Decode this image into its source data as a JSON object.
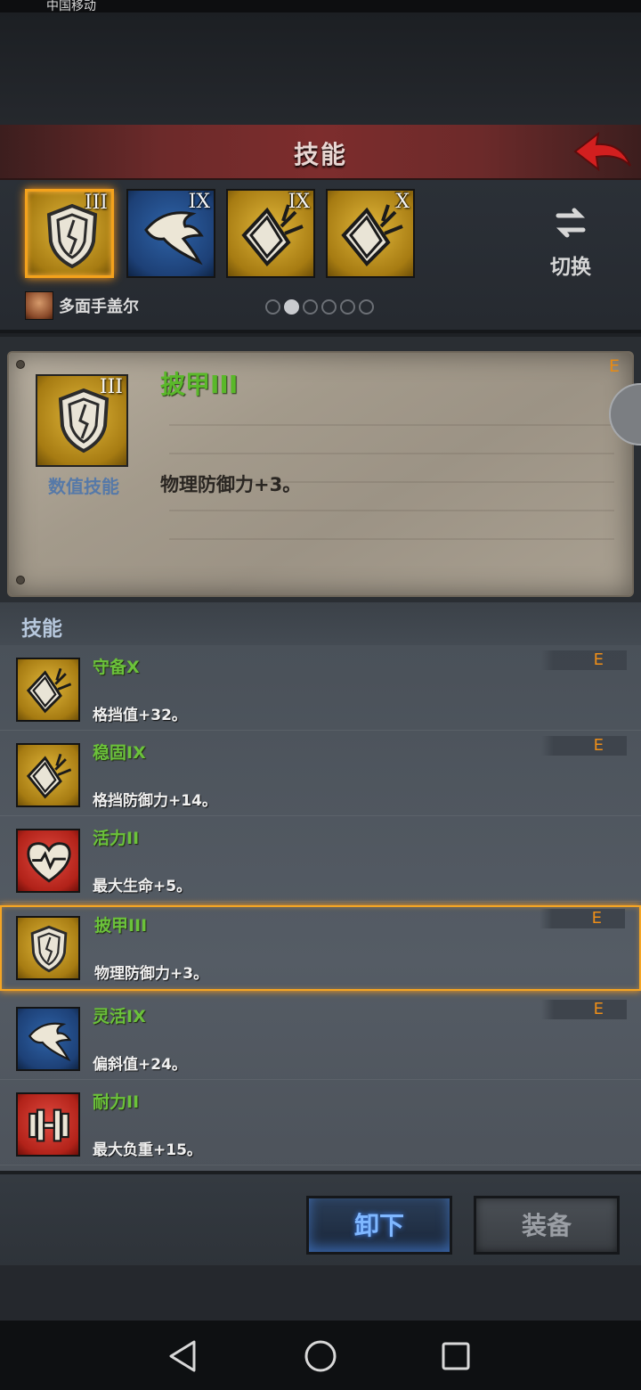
{
  "status_bar": {
    "carrier": "中国移动",
    "right": ""
  },
  "header": {
    "title": "技能"
  },
  "slots": [
    {
      "icon": "shield-icon",
      "roman": "III",
      "color": "gold",
      "selected": true
    },
    {
      "icon": "feather-icon",
      "roman": "IX",
      "color": "blue",
      "selected": false
    },
    {
      "icon": "block-shield-icon",
      "roman": "IX",
      "color": "gold",
      "selected": false
    },
    {
      "icon": "block-shield-icon",
      "roman": "X",
      "color": "gold",
      "selected": false
    }
  ],
  "switch_label": "切换",
  "character": {
    "name": "多面手盖尔"
  },
  "page_dots": {
    "total": 6,
    "active_index": 1
  },
  "detail": {
    "name": "披甲III",
    "roman": "III",
    "type": "数值技能",
    "desc": "物理防御力+3。",
    "grade": "E"
  },
  "list_header": "技能",
  "skills": [
    {
      "name": "守备X",
      "desc": "格挡值+32。",
      "grade": "E",
      "icon": "block-shield-icon",
      "color": "gold"
    },
    {
      "name": "稳固IX",
      "desc": "格挡防御力+14。",
      "grade": "E",
      "icon": "block-shield-icon",
      "color": "gold"
    },
    {
      "name": "活力II",
      "desc": "最大生命+5。",
      "grade": "",
      "icon": "heart-icon",
      "color": "red"
    },
    {
      "name": "披甲III",
      "desc": "物理防御力+3。",
      "grade": "E",
      "icon": "shield-icon",
      "color": "gold",
      "selected": true
    },
    {
      "name": "灵活IX",
      "desc": "偏斜值+24。",
      "grade": "E",
      "icon": "feather-icon",
      "color": "blue"
    },
    {
      "name": "耐力II",
      "desc": "最大负重+15。",
      "grade": "",
      "icon": "dumbbell-icon",
      "color": "red"
    }
  ],
  "buttons": {
    "unequip": "卸下",
    "equip": "装备"
  },
  "colors": {
    "accent": "#f5a524",
    "skill_name": "#6bc23a",
    "grade": "#ee8e18"
  }
}
